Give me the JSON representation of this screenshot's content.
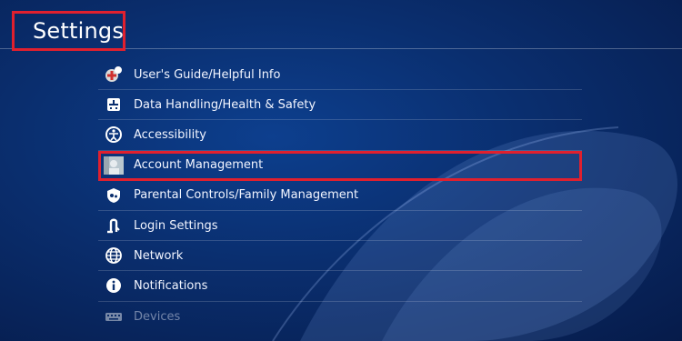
{
  "header": {
    "title": "Settings"
  },
  "menu": {
    "items": [
      {
        "label": "User's Guide/Helpful Info",
        "icon": "guide-icon"
      },
      {
        "label": "Data Handling/Health & Safety",
        "icon": "data-handling-icon"
      },
      {
        "label": "Accessibility",
        "icon": "accessibility-icon"
      },
      {
        "label": "Account Management",
        "icon": "account-avatar-icon"
      },
      {
        "label": "Parental Controls/Family Management",
        "icon": "parental-controls-icon"
      },
      {
        "label": "Login Settings",
        "icon": "login-icon"
      },
      {
        "label": "Network",
        "icon": "globe-icon"
      },
      {
        "label": "Notifications",
        "icon": "info-icon"
      },
      {
        "label": "Devices",
        "icon": "keyboard-icon"
      }
    ]
  },
  "colors": {
    "background": "#0a2e6e",
    "highlight": "#e0202e",
    "text": "#ffffff"
  }
}
